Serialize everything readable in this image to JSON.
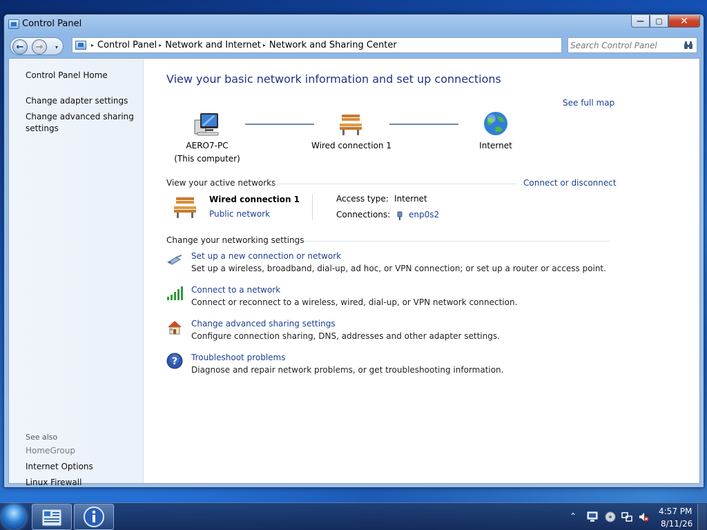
{
  "window": {
    "title": "Control Panel",
    "minimize_glyph": "—",
    "maximize_glyph": "▢",
    "close_glyph": "✕"
  },
  "nav": {
    "back_glyph": "←",
    "forward_glyph": "→",
    "recent_glyph": "▾"
  },
  "address": {
    "crumbs": [
      "Control Panel",
      "Network and Internet",
      "Network and Sharing Center"
    ],
    "separator_glyph": "▸"
  },
  "search": {
    "placeholder": "Search Control Panel"
  },
  "sidebar": {
    "home": "Control Panel Home",
    "adapter": "Change adapter settings",
    "advanced": "Change advanced sharing settings",
    "see_also": "See also",
    "homegroup": "HomeGroup",
    "internet_options": "Internet Options",
    "firewall": "Linux Firewall"
  },
  "main": {
    "heading": "View your basic network information and set up connections",
    "see_full_map": "See full map",
    "map": {
      "computer_name": "AERO7-PC",
      "computer_sub": "(This computer)",
      "connection": "Wired connection 1",
      "internet": "Internet"
    },
    "active": {
      "section_title": "View your active networks",
      "connect_link": "Connect or disconnect",
      "name": "Wired connection 1",
      "type": "Public network",
      "access_label": "Access type:",
      "access_value": "Internet",
      "connections_label": "Connections:",
      "connections_value": "enp0s2"
    },
    "settings": {
      "section_title": "Change your networking settings",
      "tasks": [
        {
          "link": "Set up a new connection or network",
          "desc": "Set up a wireless, broadband, dial-up, ad hoc, or VPN connection; or set up a router or access point.",
          "icon": "setup-connection-icon"
        },
        {
          "link": "Connect to a network",
          "desc": "Connect or reconnect to a wireless, wired, dial-up, or VPN network connection.",
          "icon": "signal-bars-icon"
        },
        {
          "link": "Change advanced sharing settings",
          "desc": "Configure connection sharing, DNS, addresses and other adapter settings.",
          "icon": "home-icon"
        },
        {
          "link": "Troubleshoot problems",
          "desc": "Diagnose and repair network problems, or get troubleshooting information.",
          "icon": "help-icon"
        }
      ]
    }
  },
  "taskbar": {
    "tray_up_glyph": "⌃",
    "time": "4:57 PM",
    "date": "8/11/26"
  },
  "colors": {
    "link": "#1c3f94",
    "heading": "#1e3287",
    "sidebar_bg": "#eaf1f9"
  }
}
